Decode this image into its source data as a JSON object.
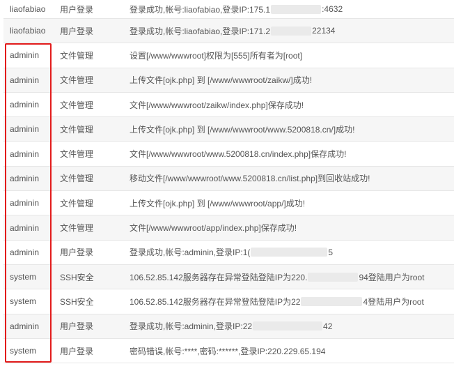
{
  "colors": {
    "highlight": "#e21b1b",
    "row_alt": "#f6f6f6",
    "border": "#e6e6e6",
    "text": "#555555"
  },
  "logs": [
    {
      "user": "liaofabiao",
      "type": "用户登录",
      "detail_pre": "登录成功,帐号:liaofabiao,登录IP:175.1",
      "redacted": true,
      "detail_post": ":4632"
    },
    {
      "user": "liaofabiao",
      "type": "用户登录",
      "detail_pre": "登录成功,帐号:liaofabiao,登录IP:171.2",
      "redacted": true,
      "detail_post": "22134"
    },
    {
      "user": "adminin",
      "type": "文件管理",
      "detail_pre": "设置[/www/wwwroot]权限为[555]所有者为[root]",
      "redacted": false,
      "detail_post": ""
    },
    {
      "user": "adminin",
      "type": "文件管理",
      "detail_pre": "上传文件[ojk.php] 到 [/www/wwwroot/zaikw/]成功!",
      "redacted": false,
      "detail_post": ""
    },
    {
      "user": "adminin",
      "type": "文件管理",
      "detail_pre": "文件[/www/wwwroot/zaikw/index.php]保存成功!",
      "redacted": false,
      "detail_post": ""
    },
    {
      "user": "adminin",
      "type": "文件管理",
      "detail_pre": "上传文件[ojk.php] 到 [/www/wwwroot/www.5200818.cn/]成功!",
      "redacted": false,
      "detail_post": ""
    },
    {
      "user": "adminin",
      "type": "文件管理",
      "detail_pre": "文件[/www/wwwroot/www.5200818.cn/index.php]保存成功!",
      "redacted": false,
      "detail_post": ""
    },
    {
      "user": "adminin",
      "type": "文件管理",
      "detail_pre": "移动文件[/www/wwwroot/www.5200818.cn/list.php]到回收站成功!",
      "redacted": false,
      "detail_post": ""
    },
    {
      "user": "adminin",
      "type": "文件管理",
      "detail_pre": "上传文件[ojk.php] 到 [/www/wwwroot/app/]成功!",
      "redacted": false,
      "detail_post": ""
    },
    {
      "user": "adminin",
      "type": "文件管理",
      "detail_pre": "文件[/www/wwwroot/app/index.php]保存成功!",
      "redacted": false,
      "detail_post": ""
    },
    {
      "user": "adminin",
      "type": "用户登录",
      "detail_pre": "登录成功,帐号:adminin,登录IP:1(",
      "redacted": true,
      "detail_post": "5"
    },
    {
      "user": "system",
      "type": "SSH安全",
      "detail_pre": "106.52.85.142服务器存在异常登陆登陆IP为220.",
      "redacted": true,
      "detail_post": "94登陆用户为root"
    },
    {
      "user": "system",
      "type": "SSH安全",
      "detail_pre": "106.52.85.142服务器存在异常登陆登陆IP为22",
      "redacted": true,
      "detail_post": "4登陆用户为root"
    },
    {
      "user": "adminin",
      "type": "用户登录",
      "detail_pre": "登录成功,帐号:adminin,登录IP:22",
      "redacted": true,
      "detail_post": "42"
    },
    {
      "user": "system",
      "type": "用户登录",
      "detail_pre": "密码错误,帐号:****,密码:******,登录IP:220.229.65.194",
      "redacted": false,
      "detail_post": ""
    }
  ]
}
